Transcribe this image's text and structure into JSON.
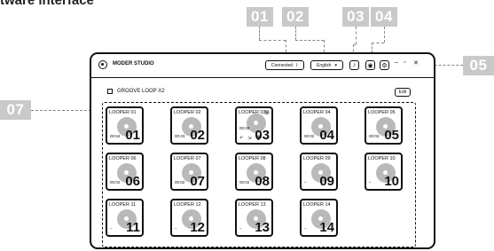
{
  "heading": "tware interface",
  "callouts": [
    "01",
    "02",
    "03",
    "04",
    "05",
    "07"
  ],
  "app": {
    "title": "MODER STUDIO",
    "connected_label": "Connected",
    "language": "English",
    "window_controls": [
      "–",
      "▫",
      "✕"
    ]
  },
  "group": {
    "title": "GROOVE LOOP X2",
    "edit_label": "Edit"
  },
  "loopers": [
    {
      "name": "LOOPER 01",
      "time": "00:53",
      "num": "01"
    },
    {
      "name": "LOOPER 02",
      "time": "00:43",
      "num": "02"
    },
    {
      "name": "LOOPER 03",
      "time": "00:20",
      "num": "03",
      "active": true
    },
    {
      "name": "LOOPER 04",
      "time": "00:02",
      "num": "04"
    },
    {
      "name": "LOOPER 05",
      "time": "00:03",
      "num": "05"
    },
    {
      "name": "LOOPER 06",
      "time": "00:02",
      "num": "06"
    },
    {
      "name": "LOOPER 07",
      "time": "00:02",
      "num": "07"
    },
    {
      "name": "LOOPER 08",
      "time": "00:02",
      "num": "08"
    },
    {
      "name": "LOOPER 09",
      "time": "–",
      "num": "09"
    },
    {
      "name": "LOOPER 10",
      "time": "–",
      "num": "10"
    },
    {
      "name": "LOOPER 11",
      "time": "–",
      "num": "11"
    },
    {
      "name": "LOOPER 12",
      "time": "–",
      "num": "12"
    },
    {
      "name": "LOOPER 13",
      "time": "–",
      "num": "13"
    },
    {
      "name": "LOOPER 14",
      "time": "–",
      "num": "14"
    }
  ],
  "icons": [
    "logo-icon",
    "bluetooth-icon",
    "dropdown-icon",
    "headphones-icon",
    "record-icon",
    "settings-icon",
    "add-icon",
    "undo-icon",
    "import-icon",
    "trash-icon",
    "disc-icon"
  ]
}
